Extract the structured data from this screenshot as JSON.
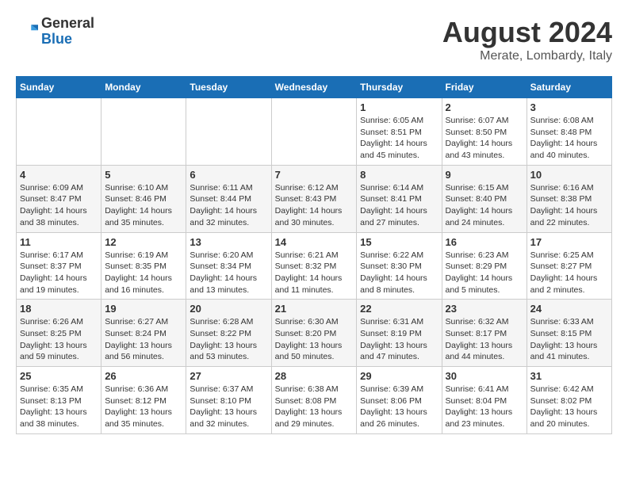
{
  "logo": {
    "text_general": "General",
    "text_blue": "Blue"
  },
  "header": {
    "title": "August 2024",
    "subtitle": "Merate, Lombardy, Italy"
  },
  "weekdays": [
    "Sunday",
    "Monday",
    "Tuesday",
    "Wednesday",
    "Thursday",
    "Friday",
    "Saturday"
  ],
  "weeks": [
    [
      {
        "day": "",
        "info": ""
      },
      {
        "day": "",
        "info": ""
      },
      {
        "day": "",
        "info": ""
      },
      {
        "day": "",
        "info": ""
      },
      {
        "day": "1",
        "info": "Sunrise: 6:05 AM\nSunset: 8:51 PM\nDaylight: 14 hours\nand 45 minutes."
      },
      {
        "day": "2",
        "info": "Sunrise: 6:07 AM\nSunset: 8:50 PM\nDaylight: 14 hours\nand 43 minutes."
      },
      {
        "day": "3",
        "info": "Sunrise: 6:08 AM\nSunset: 8:48 PM\nDaylight: 14 hours\nand 40 minutes."
      }
    ],
    [
      {
        "day": "4",
        "info": "Sunrise: 6:09 AM\nSunset: 8:47 PM\nDaylight: 14 hours\nand 38 minutes."
      },
      {
        "day": "5",
        "info": "Sunrise: 6:10 AM\nSunset: 8:46 PM\nDaylight: 14 hours\nand 35 minutes."
      },
      {
        "day": "6",
        "info": "Sunrise: 6:11 AM\nSunset: 8:44 PM\nDaylight: 14 hours\nand 32 minutes."
      },
      {
        "day": "7",
        "info": "Sunrise: 6:12 AM\nSunset: 8:43 PM\nDaylight: 14 hours\nand 30 minutes."
      },
      {
        "day": "8",
        "info": "Sunrise: 6:14 AM\nSunset: 8:41 PM\nDaylight: 14 hours\nand 27 minutes."
      },
      {
        "day": "9",
        "info": "Sunrise: 6:15 AM\nSunset: 8:40 PM\nDaylight: 14 hours\nand 24 minutes."
      },
      {
        "day": "10",
        "info": "Sunrise: 6:16 AM\nSunset: 8:38 PM\nDaylight: 14 hours\nand 22 minutes."
      }
    ],
    [
      {
        "day": "11",
        "info": "Sunrise: 6:17 AM\nSunset: 8:37 PM\nDaylight: 14 hours\nand 19 minutes."
      },
      {
        "day": "12",
        "info": "Sunrise: 6:19 AM\nSunset: 8:35 PM\nDaylight: 14 hours\nand 16 minutes."
      },
      {
        "day": "13",
        "info": "Sunrise: 6:20 AM\nSunset: 8:34 PM\nDaylight: 14 hours\nand 13 minutes."
      },
      {
        "day": "14",
        "info": "Sunrise: 6:21 AM\nSunset: 8:32 PM\nDaylight: 14 hours\nand 11 minutes."
      },
      {
        "day": "15",
        "info": "Sunrise: 6:22 AM\nSunset: 8:30 PM\nDaylight: 14 hours\nand 8 minutes."
      },
      {
        "day": "16",
        "info": "Sunrise: 6:23 AM\nSunset: 8:29 PM\nDaylight: 14 hours\nand 5 minutes."
      },
      {
        "day": "17",
        "info": "Sunrise: 6:25 AM\nSunset: 8:27 PM\nDaylight: 14 hours\nand 2 minutes."
      }
    ],
    [
      {
        "day": "18",
        "info": "Sunrise: 6:26 AM\nSunset: 8:25 PM\nDaylight: 13 hours\nand 59 minutes."
      },
      {
        "day": "19",
        "info": "Sunrise: 6:27 AM\nSunset: 8:24 PM\nDaylight: 13 hours\nand 56 minutes."
      },
      {
        "day": "20",
        "info": "Sunrise: 6:28 AM\nSunset: 8:22 PM\nDaylight: 13 hours\nand 53 minutes."
      },
      {
        "day": "21",
        "info": "Sunrise: 6:30 AM\nSunset: 8:20 PM\nDaylight: 13 hours\nand 50 minutes."
      },
      {
        "day": "22",
        "info": "Sunrise: 6:31 AM\nSunset: 8:19 PM\nDaylight: 13 hours\nand 47 minutes."
      },
      {
        "day": "23",
        "info": "Sunrise: 6:32 AM\nSunset: 8:17 PM\nDaylight: 13 hours\nand 44 minutes."
      },
      {
        "day": "24",
        "info": "Sunrise: 6:33 AM\nSunset: 8:15 PM\nDaylight: 13 hours\nand 41 minutes."
      }
    ],
    [
      {
        "day": "25",
        "info": "Sunrise: 6:35 AM\nSunset: 8:13 PM\nDaylight: 13 hours\nand 38 minutes."
      },
      {
        "day": "26",
        "info": "Sunrise: 6:36 AM\nSunset: 8:12 PM\nDaylight: 13 hours\nand 35 minutes."
      },
      {
        "day": "27",
        "info": "Sunrise: 6:37 AM\nSunset: 8:10 PM\nDaylight: 13 hours\nand 32 minutes."
      },
      {
        "day": "28",
        "info": "Sunrise: 6:38 AM\nSunset: 8:08 PM\nDaylight: 13 hours\nand 29 minutes."
      },
      {
        "day": "29",
        "info": "Sunrise: 6:39 AM\nSunset: 8:06 PM\nDaylight: 13 hours\nand 26 minutes."
      },
      {
        "day": "30",
        "info": "Sunrise: 6:41 AM\nSunset: 8:04 PM\nDaylight: 13 hours\nand 23 minutes."
      },
      {
        "day": "31",
        "info": "Sunrise: 6:42 AM\nSunset: 8:02 PM\nDaylight: 13 hours\nand 20 minutes."
      }
    ]
  ]
}
